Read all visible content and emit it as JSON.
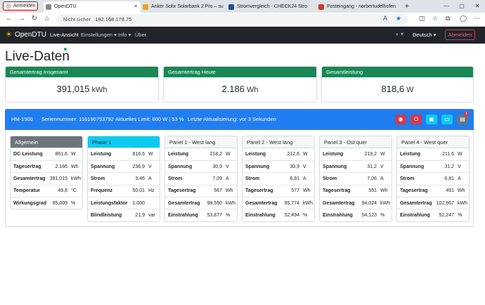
{
  "browser": {
    "signin_label": "Anmelden",
    "tabs": [
      {
        "title": "OpenDTU",
        "active": true
      },
      {
        "title": "Anker Solix Solarbank 2 Pro – su"
      },
      {
        "title": "Stromvergleich - CHECK24 Stro"
      },
      {
        "title": "Posteingang - norbertudelhofen"
      }
    ],
    "new_tab": "+",
    "url_warning": "Nicht sicher",
    "url": "192.168.178.75",
    "nav": {
      "back": "←",
      "forward": "→",
      "reload": "↻",
      "home": "⌂"
    },
    "window": {
      "min": "—",
      "max": "▢",
      "close": "✕"
    }
  },
  "navbar": {
    "brand": "OpenDTU",
    "items": [
      "Live-Ansicht",
      "Einstellungen ▾",
      "Info ▾",
      "Über"
    ],
    "language": "Deutsch ▾",
    "logout": "Abmelden",
    "theme_icon": "◐ ▾"
  },
  "page": {
    "title": "Live-Daten"
  },
  "summary": [
    {
      "label": "Gesamtertrag Insgesamt",
      "value": "391,015",
      "unit": "kWh"
    },
    {
      "label": "Gesamtertrag Heute",
      "value": "2.186",
      "unit": "Wh"
    },
    {
      "label": "Gesamtleistung",
      "value": "818,6",
      "unit": "W"
    }
  ],
  "inverter": {
    "name": "HM-1500",
    "serial": "Seriennummer: 116190753792",
    "limit": "Aktuelles Limit: 800 W | 53 %",
    "update": "Letzte Aktualisierung: vor 3 Sekunden",
    "buttons": [
      {
        "icon": "speedometer-icon",
        "glyph": "◉",
        "color": "#dc3545"
      },
      {
        "icon": "power-icon",
        "glyph": "⏻",
        "color": "#dc3545"
      },
      {
        "icon": "cpu-icon",
        "glyph": "▣",
        "color": "#0dcaf0"
      },
      {
        "icon": "monitor-icon",
        "glyph": "▭",
        "color": "#0dcaf0"
      },
      {
        "icon": "journal-icon",
        "glyph": "▤",
        "color": "#6c757d"
      }
    ],
    "badge": "1"
  },
  "panels": [
    {
      "title": "Allgemein",
      "header_bg": "#6c757d",
      "header_fg": "#ffffff",
      "rows": [
        [
          "DC-Leistung",
          "861,6",
          "W"
        ],
        [
          "Tagesertrag",
          "2.186",
          "Wh"
        ],
        [
          "Gesamtertrag",
          "391,015",
          "kWh"
        ],
        [
          "Temperatur",
          "49,8",
          "°C"
        ],
        [
          "Wirkungsgrad",
          "95,009",
          "%"
        ]
      ]
    },
    {
      "title": "Phase 1",
      "header_bg": "#0dcaf0",
      "header_fg": "#212529",
      "rows": [
        [
          "Leistung",
          "818,6",
          "W"
        ],
        [
          "Spannung",
          "236,9",
          "V"
        ],
        [
          "Strom",
          "3,46",
          "A"
        ],
        [
          "Frequenz",
          "50,01",
          "Hz"
        ],
        [
          "Leistungsfaktor",
          "1,000",
          ""
        ],
        [
          "Blindleistung",
          "21,9",
          "var"
        ]
      ]
    },
    {
      "title": "Panel 1 - West lang",
      "header_bg": "#f7f7f7",
      "header_fg": "#212529",
      "rows": [
        [
          "Leistung",
          "218,2",
          "W"
        ],
        [
          "Spannung",
          "30,9",
          "V"
        ],
        [
          "Strom",
          "7,09",
          "A"
        ],
        [
          "Tagesertrag",
          "567",
          "Wh"
        ],
        [
          "Gesamtertrag",
          "98,550",
          "kWh"
        ],
        [
          "Einstrahlung",
          "53,877",
          "%"
        ]
      ]
    },
    {
      "title": "Panel 2 - West lang",
      "header_bg": "#f7f7f7",
      "header_fg": "#212529",
      "rows": [
        [
          "Leistung",
          "212,6",
          "W"
        ],
        [
          "Spannung",
          "30,9",
          "V"
        ],
        [
          "Strom",
          "6,91",
          "A"
        ],
        [
          "Tagesertrag",
          "577",
          "Wh"
        ],
        [
          "Gesamtertrag",
          "95,774",
          "kWh"
        ],
        [
          "Einstrahlung",
          "52,494",
          "%"
        ]
      ]
    },
    {
      "title": "Panel 3 - Ost quer",
      "header_bg": "#f7f7f7",
      "header_fg": "#212529",
      "rows": [
        [
          "Leistung",
          "219,2",
          "W"
        ],
        [
          "Spannung",
          "31,2",
          "V"
        ],
        [
          "Strom",
          "7,06",
          "A"
        ],
        [
          "Tagesertrag",
          "551",
          "Wh"
        ],
        [
          "Gesamtertrag",
          "94,024",
          "kWh"
        ],
        [
          "Einstrahlung",
          "54,123",
          "%"
        ]
      ]
    },
    {
      "title": "Panel 4 - West quer",
      "header_bg": "#f7f7f7",
      "header_fg": "#212529",
      "rows": [
        [
          "Leistung",
          "211,6",
          "W"
        ],
        [
          "Spannung",
          "31,2",
          "V"
        ],
        [
          "Strom",
          "6,81",
          "A"
        ],
        [
          "Tagesertrag",
          "491",
          "Wh"
        ],
        [
          "Gesamtertrag",
          "102,667",
          "kWh"
        ],
        [
          "Einstrahlung",
          "52,247",
          "%"
        ]
      ]
    }
  ]
}
